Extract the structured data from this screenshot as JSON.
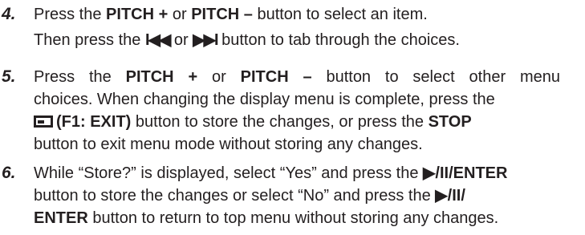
{
  "steps": [
    {
      "number": "4.",
      "lines": [
        {
          "a": "Press the ",
          "b1": "PITCH +",
          "c": " or ",
          "b2": "PITCH –",
          "d": " button to select an item."
        },
        {
          "a": "Then press the ",
          "g1": "I◀◀",
          "c": " or ",
          "g2": "▶▶I",
          "d": " button to tab through the choices."
        }
      ]
    },
    {
      "number": "5.",
      "lines": [
        {
          "a": "Press the ",
          "b1": "PITCH +",
          "c": " or ",
          "b2": "PITCH –",
          "d": " button to select other menu"
        },
        {
          "a": "choices. When changing the display menu is complete, press the"
        },
        {
          "icon": "display-icon",
          "b1": "(F1: EXIT)",
          "c": " button to store the changes, or press the ",
          "b2": "STOP"
        },
        {
          "a": "button to exit menu mode without storing any changes."
        }
      ]
    },
    {
      "number": "6.",
      "lines": [
        {
          "a": "While “Store?” is displayed, select “Yes” and press the ",
          "b1": "▶/II/ENTER"
        },
        {
          "a": "button to store the changes or select “No” and press the ",
          "b1": "▶/II/"
        },
        {
          "b1": "ENTER",
          "c": " button to return to top menu without storing any changes."
        }
      ]
    }
  ]
}
